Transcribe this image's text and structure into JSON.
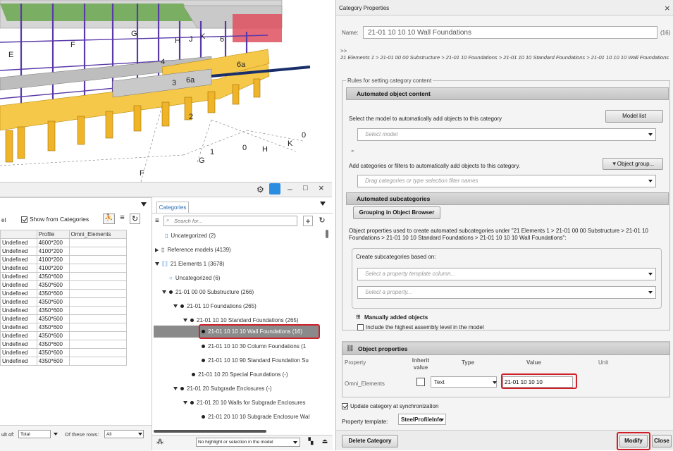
{
  "viewport": {
    "labels": [
      "E",
      "F",
      "G",
      "H",
      "J",
      "K",
      "6",
      "4",
      "3",
      "6a",
      "6a",
      "2",
      "1",
      "0",
      "G",
      "F",
      "H",
      "K",
      "0"
    ]
  },
  "window_controls": {
    "gear": "⚙",
    "minimize": "–",
    "maximize": "□",
    "close": "×"
  },
  "objects": {
    "show_from_categories": "Show from Categories",
    "left_cut_label": "el",
    "columns": [
      "",
      "Profile",
      "Omni_Elements"
    ],
    "rows": [
      [
        "Undefined",
        "4600*200",
        ""
      ],
      [
        "Undefined",
        "4100*200",
        ""
      ],
      [
        "Undefined",
        "4100*200",
        ""
      ],
      [
        "Undefined",
        "4100*200",
        ""
      ],
      [
        "Undefined",
        "4350*600",
        ""
      ],
      [
        "Undefined",
        "4350*600",
        ""
      ],
      [
        "Undefined",
        "4350*600",
        ""
      ],
      [
        "Undefined",
        "4350*600",
        ""
      ],
      [
        "Undefined",
        "4350*600",
        ""
      ],
      [
        "Undefined",
        "4350*600",
        ""
      ],
      [
        "Undefined",
        "4350*600",
        ""
      ],
      [
        "Undefined",
        "4350*600",
        ""
      ],
      [
        "Undefined",
        "4350*600",
        ""
      ],
      [
        "Undefined",
        "4350*600",
        ""
      ],
      [
        "Undefined",
        "4350*600",
        ""
      ]
    ],
    "footer_label": "ult of:",
    "footer_value": "Total",
    "footer_label2": "Of these rows:",
    "footer_value2": "All"
  },
  "categories": {
    "tab": "Categories",
    "search_placeholder": "Search for...",
    "items": [
      "Uncategorized (2)",
      "Reference models (4139)",
      "21 Elements 1 (3678)",
      "Uncategorized (6)",
      "21-01 00 00 Substructure (266)",
      "21-01 10 Foundations (265)",
      "21-01 10 10 Standard Foundations (265)",
      "21-01 10 10 10 Wall Foundations (16)",
      "21-01 10 10 30 Column Foundations (1",
      "21-01 10 10 90 Standard Foundation Su",
      "21-01 10 20 Special Foundations (-)",
      "21-01 20 Subgrade Enclosures (-)",
      "21-01 20 10 Walls for Subgrade Enclosures",
      "21-01 20 10 10 Subgrade Enclosure Wal"
    ],
    "highlight_select": "No highlight or selection in the model"
  },
  "dialog": {
    "title": "Category Properties",
    "name_label": "Name:",
    "name_value": "21-01 10 10 10 Wall Foundations",
    "count": "(16)",
    "path_marker": ">>",
    "path": "21 Elements 1 > 21-01 00 00 Substructure > 21-01 10 Foundations > 21-01 10 10 Standard Foundations > 21-01 10 10 10 Wall Foundations",
    "rules_label": "Rules for setting category content",
    "automated_object_content": "Automated object content",
    "select_model_text": "Select the model to automatically add objects to this category",
    "model_list_button": "Model list",
    "select_model_placeholder": "Select model",
    "add_categories_text": "Add categories or filters to automatically add objects to this category.",
    "object_group_button": "Object group...",
    "drag_placeholder": "Drag categories or type selection filter names",
    "automated_subcategories": "Automated subcategories",
    "grouping_button": "Grouping in Object Browser",
    "subcat_text": "Object properties used to create automated subcategories under \"21 Elements 1 > 21-01 00 00 Substructure > 21-01 10 Foundations > 21-01 10 10 Standard Foundations > 21-01 10 10 10 Wall Foundations\":",
    "create_subcats_label": "Create subcategories based on:",
    "select_column_placeholder": "Select a property template column...",
    "select_property_placeholder": "Select a property...",
    "manually_added": "Manually added objects",
    "include_highest": "Include the highest assembly level in the model",
    "object_properties": "Object properties",
    "prop_headers": [
      "Property",
      "Inherit value",
      "Type",
      "Value",
      "Unit"
    ],
    "prop_row": {
      "property": "Omni_Elements",
      "type": "Text",
      "value": "21-01 10 10 10"
    },
    "update_sync": "Update category at synchronization",
    "property_template_label": "Property template:",
    "property_template_value": "SteelProfileInfo",
    "delete_button": "Delete Category",
    "modify_button": "Modify",
    "close_button": "Close"
  }
}
